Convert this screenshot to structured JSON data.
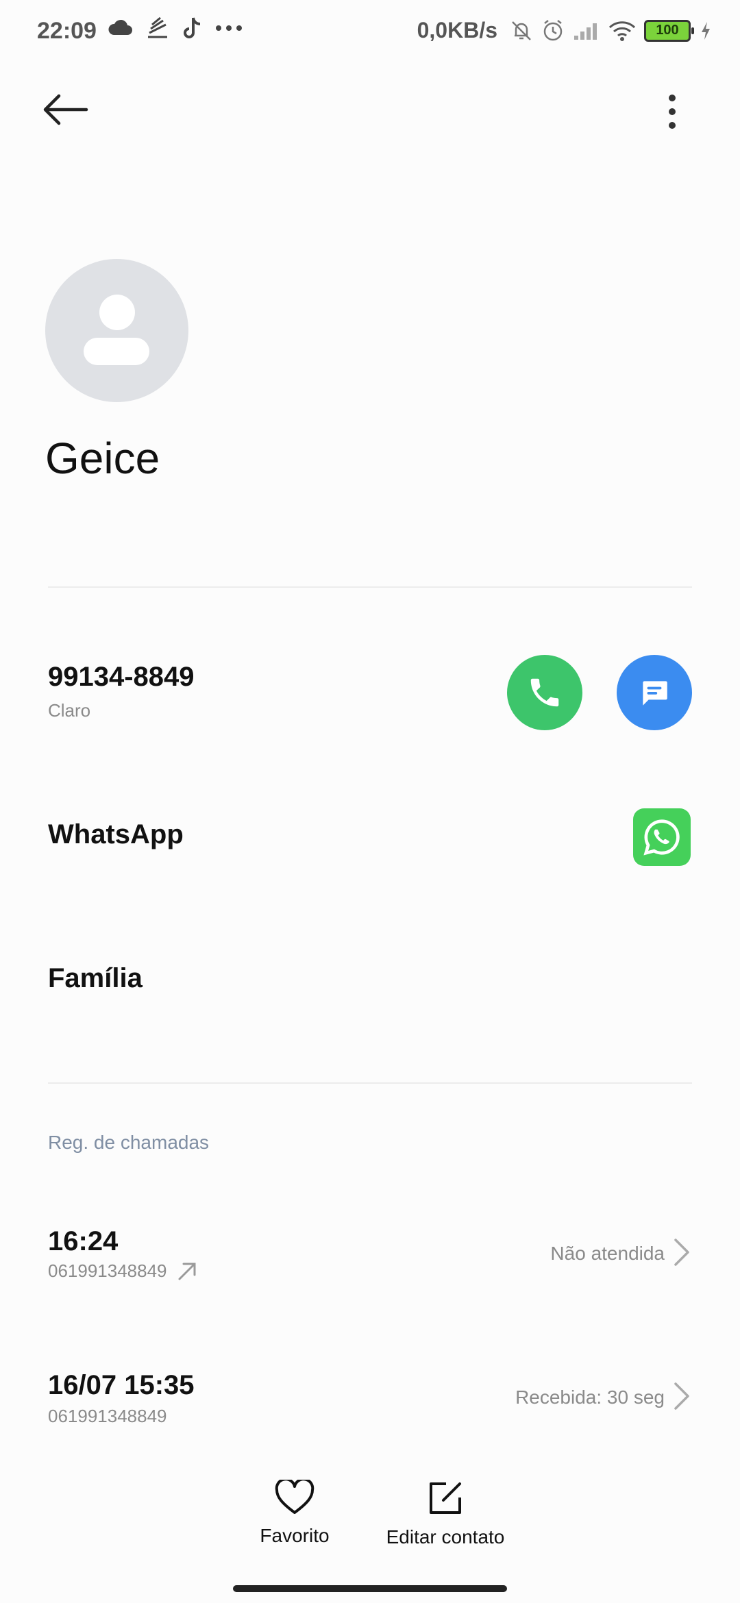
{
  "status_bar": {
    "time": "22:09",
    "network_speed": "0,0KB/s",
    "battery": "100",
    "left_icons": [
      "cloud-icon",
      "fan-icon",
      "tiktok-icon",
      "more-dots-icon"
    ],
    "right_icons": [
      "bell-muted-icon",
      "alarm-icon",
      "signal-icon",
      "wifi-icon",
      "battery-icon",
      "charging-icon"
    ]
  },
  "contact": {
    "name": "Geice",
    "phone": "99134-8849",
    "carrier": "Claro",
    "whatsapp_label": "WhatsApp",
    "group": "Família"
  },
  "call_log": {
    "title": "Reg. de chamadas",
    "entries": [
      {
        "time": "16:24",
        "number": "061991348849",
        "status": "Não atendida",
        "outgoing_arrow": true
      },
      {
        "time": "16/07 15:35",
        "number": "061991348849",
        "status": "Recebida: 30 seg",
        "outgoing_arrow": false
      }
    ]
  },
  "bottom_bar": {
    "favorite_label": "Favorito",
    "edit_label": "Editar contato"
  },
  "colors": {
    "call_green": "#3dc56b",
    "message_blue": "#3b8cf0",
    "whatsapp_green": "#45d05a",
    "avatar_gray": "#dfe1e5"
  }
}
